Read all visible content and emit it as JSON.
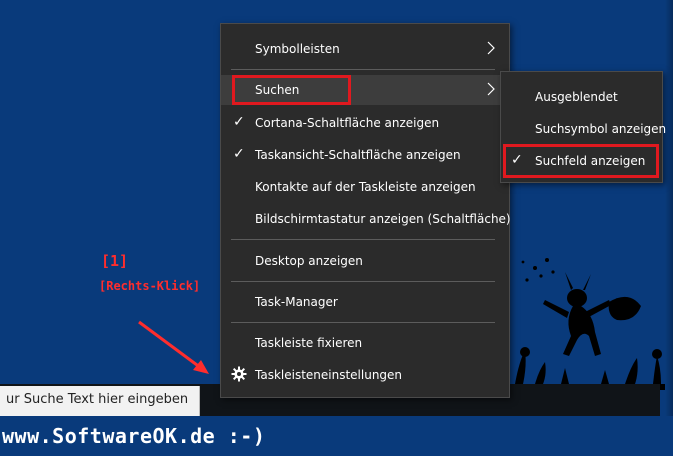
{
  "taskbar": {
    "search_placeholder": "ur Suche Text hier eingeben"
  },
  "brand": "www.SoftwareOK.de :-)",
  "annotation": {
    "number": "[1]",
    "label": "[Rechts-Klick]",
    "color": "#ff2d2d"
  },
  "context_menu": {
    "items": [
      {
        "label": "Symbolleisten",
        "has_submenu": true,
        "checked": false
      },
      {
        "label": "Suchen",
        "has_submenu": true,
        "checked": false,
        "highlighted": true
      },
      {
        "label": "Cortana-Schaltfläche anzeigen",
        "checked": true
      },
      {
        "label": "Taskansicht-Schaltfläche anzeigen",
        "checked": true
      },
      {
        "label": "Kontakte auf der Taskleiste anzeigen",
        "checked": false
      },
      {
        "label": "Bildschirmtastatur anzeigen (Schaltfläche)",
        "checked": false
      },
      {
        "label": "Desktop anzeigen",
        "checked": false
      },
      {
        "label": "Task-Manager",
        "checked": false
      },
      {
        "label": "Taskleiste fixieren",
        "checked": false
      },
      {
        "label": "Taskleisteneinstellungen",
        "icon": "gear-icon",
        "checked": false
      }
    ]
  },
  "search_submenu": {
    "items": [
      {
        "label": "Ausgeblendet",
        "checked": false
      },
      {
        "label": "Suchsymbol anzeigen",
        "checked": false
      },
      {
        "label": "Suchfeld anzeigen",
        "checked": true,
        "highlighted": true
      }
    ]
  },
  "colors": {
    "desktop": "#093a7b",
    "menu_bg": "#2b2b2b",
    "highlight_box": "#e0191f"
  }
}
